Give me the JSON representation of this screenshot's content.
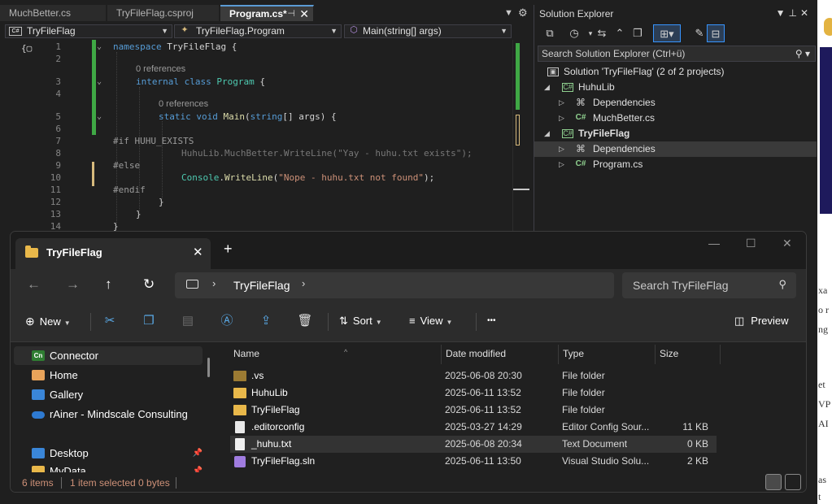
{
  "vs": {
    "tabs": [
      "MuchBetter.cs",
      "TryFileFlag.csproj",
      "Program.cs*"
    ],
    "tab_pin_icon": "pin-icon",
    "nav": {
      "project": "TryFileFlag",
      "type": "TryFileFlag.Program",
      "member": "Main(string[] args)"
    },
    "lines": [
      "1",
      "2",
      "3",
      "4",
      "5",
      "6",
      "7",
      "8",
      "9",
      "10",
      "11",
      "12",
      "13",
      "14"
    ],
    "code": {
      "l1_kw": "namespace",
      "l1_rest": " TryFileFlag {",
      "lens1": "0 references",
      "l3_kw": "internal class",
      "l3_ty": " Program",
      "l3_rest": " {",
      "lens2": "0 references",
      "l5_kw": "static void",
      "l5_fn": " Main",
      "l5_p1": "(",
      "l5_kw2": "string",
      "l5_p2": "[] args) {",
      "l7": "#if HUHU_EXISTS",
      "l8_a": "HuhuLib.MuchBetter.WriteLine(",
      "l8_s": "\"Yay - huhu.txt exists\"",
      "l8_b": ");",
      "l9": "#else",
      "l10_ty": "Console",
      "l10_a": ".",
      "l10_fn": "WriteLine",
      "l10_b": "(",
      "l10_s": "\"Nope - huhu.txt not found\"",
      "l10_c": ");",
      "l11": "#endif",
      "l12": "}",
      "l13": "}",
      "l14": "}"
    }
  },
  "solution": {
    "title": "Solution Explorer",
    "search_placeholder": "Search Solution Explorer (Ctrl+ü)",
    "tree": {
      "solution": "Solution 'TryFileFlag' (2 of 2 projects)",
      "proj1": "HuhuLib",
      "proj1_deps": "Dependencies",
      "proj1_file": "MuchBetter.cs",
      "proj2": "TryFileFlag",
      "proj2_deps": "Dependencies",
      "proj2_file": "Program.cs"
    },
    "icon_badges": {
      "cs": "C#"
    }
  },
  "explorer": {
    "tab_title": "TryFileFlag",
    "breadcrumb": "TryFileFlag",
    "search_placeholder": "Search TryFileFlag",
    "commands": {
      "new": "New",
      "sort": "Sort",
      "view": "View",
      "more": "•••",
      "preview": "Preview"
    },
    "nav": {
      "connector": "Connector",
      "connector_badge": "Cn",
      "home": "Home",
      "gallery": "Gallery",
      "onedrive": "rAiner - Mindscale Consulting",
      "desktop": "Desktop",
      "mydata": "MyData"
    },
    "columns": {
      "name": "Name",
      "date": "Date modified",
      "type": "Type",
      "size": "Size"
    },
    "files": [
      {
        "name": ".vs",
        "date": "2025-06-08 20:30",
        "type": "File folder",
        "size": ""
      },
      {
        "name": "HuhuLib",
        "date": "2025-06-11 13:52",
        "type": "File folder",
        "size": ""
      },
      {
        "name": "TryFileFlag",
        "date": "2025-06-11 13:52",
        "type": "File folder",
        "size": ""
      },
      {
        "name": ".editorconfig",
        "date": "2025-03-27 14:29",
        "type": "Editor Config Sour...",
        "size": "11 KB"
      },
      {
        "name": "_huhu.txt",
        "date": "2025-06-08 20:34",
        "type": "Text Document",
        "size": "0 KB"
      },
      {
        "name": "TryFileFlag.sln",
        "date": "2025-06-11 13:50",
        "type": "Visual Studio Solu...",
        "size": "2 KB"
      }
    ],
    "status": {
      "items": "6 items",
      "selected": "1 item selected  0 bytes"
    }
  },
  "right_strip": {
    "fragments": [
      "xa",
      "o r",
      "ng",
      "et",
      "VP",
      "AI",
      "as",
      "t"
    ]
  },
  "colors": {
    "accent": "#5b9bd5",
    "change_saved": "#3fa845",
    "change_unsaved": "#d7ba7d",
    "folder": "#e9b84a"
  }
}
